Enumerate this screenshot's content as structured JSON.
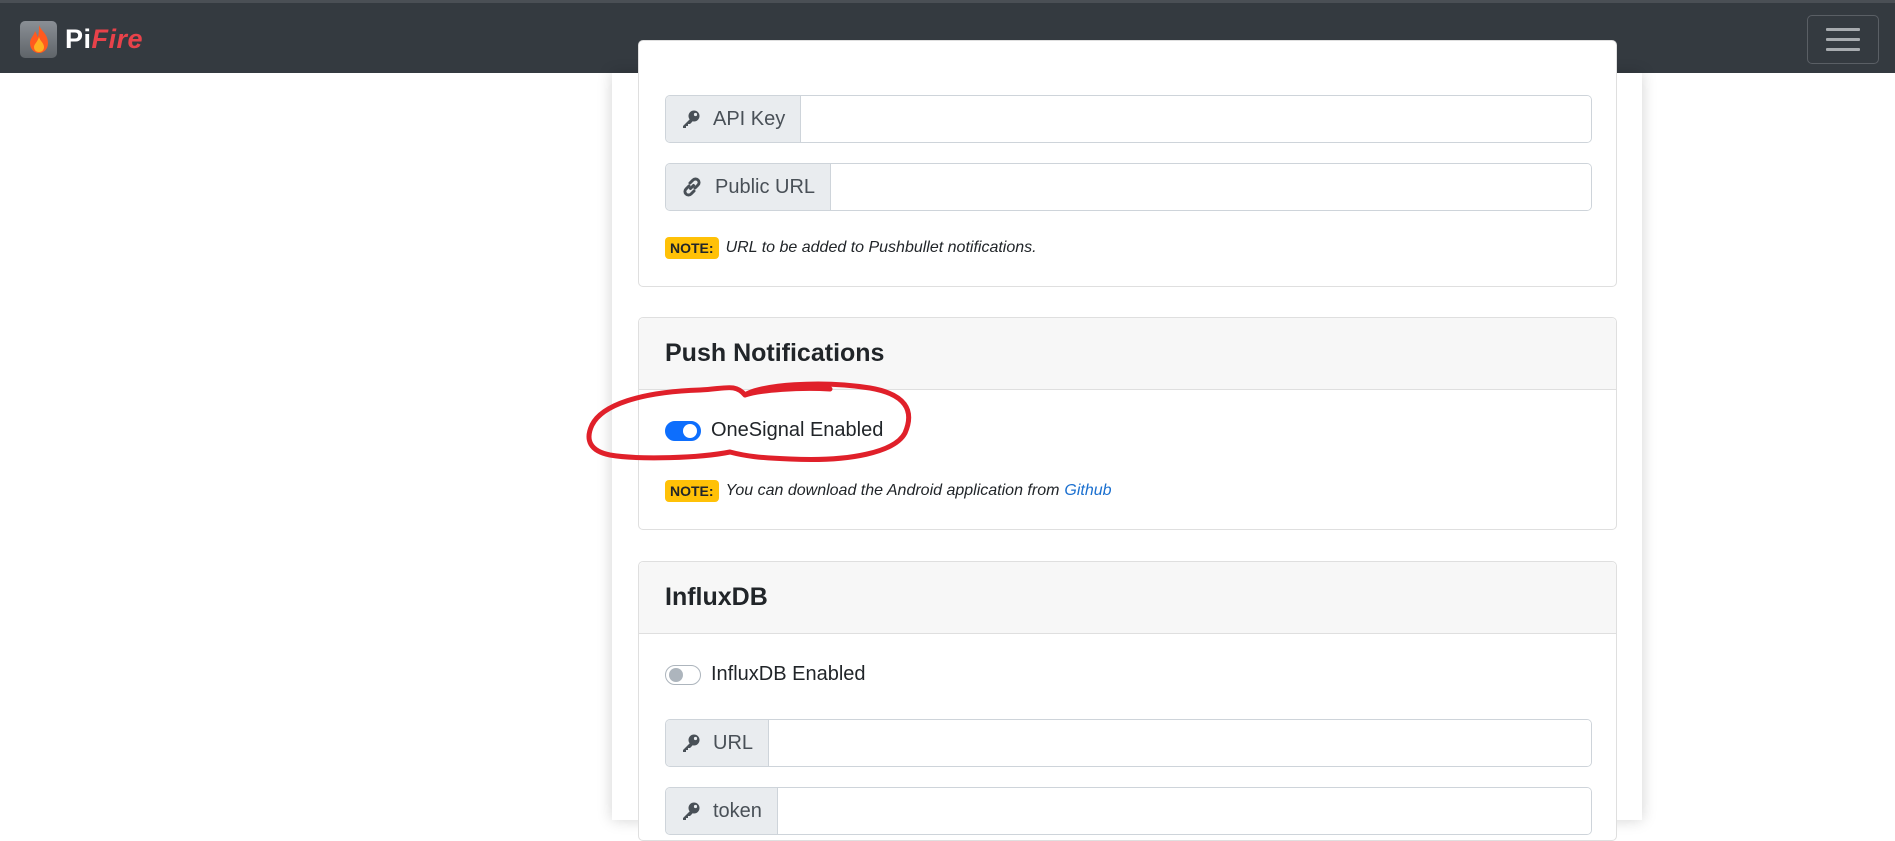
{
  "navbar": {
    "brand_pi": "Pi",
    "brand_fire": "Fire",
    "logo_icon": "flame-icon",
    "menu_icon": "hamburger-icon",
    "background_color": "#343a40"
  },
  "pushbullet": {
    "api_key_label": "API Key",
    "api_key_value": "",
    "public_url_label": "Public URL",
    "public_url_value": "",
    "note_badge": "NOTE:",
    "note_text": "URL to be added to Pushbullet notifications."
  },
  "push_notifications": {
    "title": "Push Notifications",
    "onesignal_label": "OneSignal Enabled",
    "onesignal_enabled": true,
    "note_badge": "NOTE:",
    "note_text": "You can download the Android application from",
    "note_link": "Github"
  },
  "influxdb": {
    "title": "InfluxDB",
    "enabled_label": "InfluxDB Enabled",
    "enabled": false,
    "url_label": "URL",
    "url_value": "",
    "token_label": "token",
    "token_value": ""
  },
  "colors": {
    "accent": "#0d6efd",
    "note_badge": "#ffc107",
    "annotation": "#e0202a",
    "link": "#1a6fcf"
  }
}
